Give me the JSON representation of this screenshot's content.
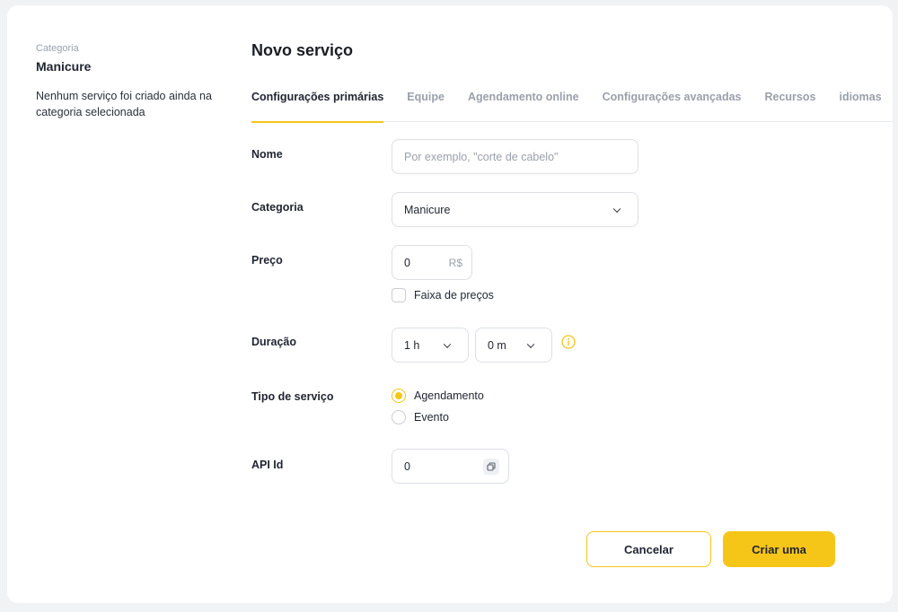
{
  "sidebar": {
    "category_label": "Categoria",
    "category_name": "Manicure",
    "empty_message": "Nenhum serviço foi criado ainda na categoria selecionada"
  },
  "header": {
    "title": "Novo serviço"
  },
  "tabs": [
    {
      "label": "Configurações primárias",
      "active": true
    },
    {
      "label": "Equipe",
      "active": false
    },
    {
      "label": "Agendamento online",
      "active": false
    },
    {
      "label": "Configurações avançadas",
      "active": false
    },
    {
      "label": "Recursos",
      "active": false
    },
    {
      "label": "idiomas",
      "active": false
    }
  ],
  "form": {
    "name": {
      "label": "Nome",
      "value": "",
      "placeholder": "Por exemplo, \"corte de cabelo\""
    },
    "category": {
      "label": "Categoria",
      "value": "Manicure"
    },
    "price": {
      "label": "Preço",
      "value": "0",
      "currency": "R$",
      "range_label": "Faixa de preços",
      "range_checked": false
    },
    "duration": {
      "label": "Duração",
      "hours": "1 h",
      "minutes": "0 m"
    },
    "service_type": {
      "label": "Tipo de serviço",
      "options": [
        {
          "label": "Agendamento",
          "selected": true
        },
        {
          "label": "Evento",
          "selected": false
        }
      ]
    },
    "api_id": {
      "label": "API Id",
      "value": "0"
    }
  },
  "actions": {
    "cancel_label": "Cancelar",
    "create_label": "Criar uma"
  },
  "colors": {
    "accent": "#f5c518",
    "background": "#f1f2f4",
    "card": "#ffffff"
  },
  "icons": {
    "chevron": "chevron-down-icon",
    "info": "info-icon",
    "copy": "copy-icon"
  }
}
